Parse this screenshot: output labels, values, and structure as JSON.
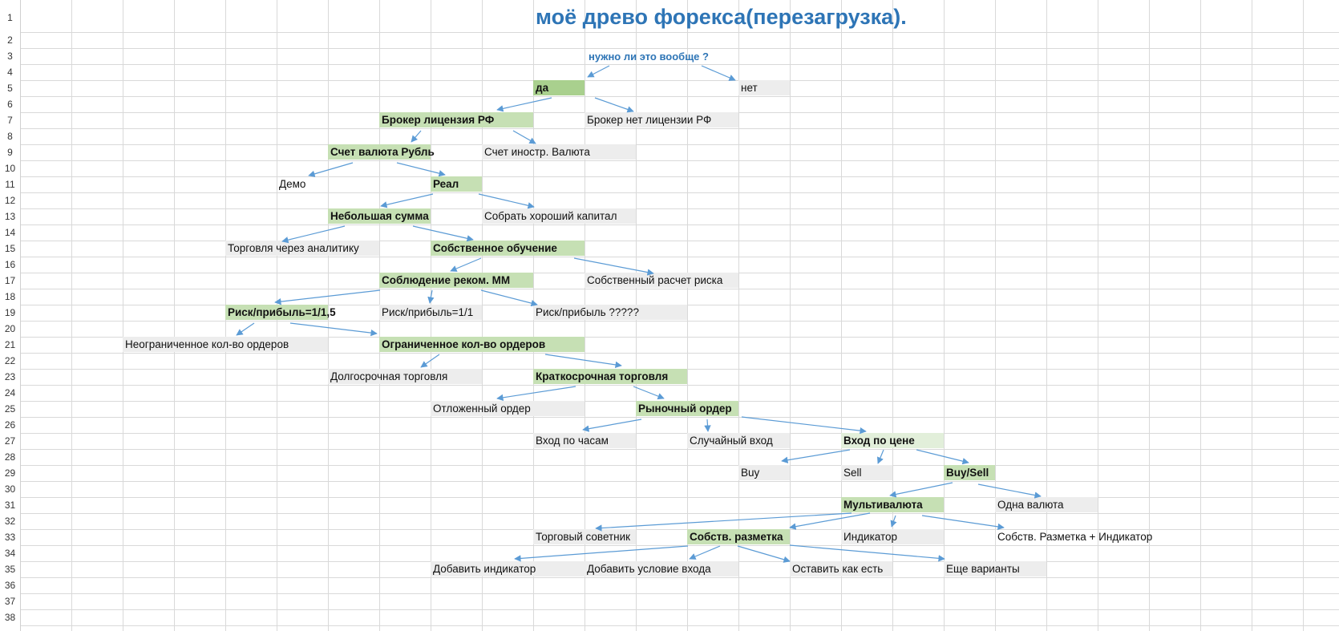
{
  "title": "моё древо форекса(перезагрузка).",
  "question": "нужно ли это вообще ?",
  "rows": [
    "1",
    "2",
    "3",
    "4",
    "5",
    "6",
    "7",
    "8",
    "9",
    "10",
    "11",
    "12",
    "13",
    "14",
    "15",
    "16",
    "17",
    "18",
    "19",
    "20",
    "21",
    "22",
    "23",
    "24",
    "25",
    "26",
    "27",
    "28",
    "29",
    "30",
    "31",
    "32",
    "33",
    "34",
    "35",
    "36",
    "37",
    "38"
  ],
  "nodes": {
    "da": "да",
    "net": "нет",
    "broker_rf": "Брокер лицензия РФ",
    "broker_no_rf": "Брокер нет лицензии РФ",
    "rub": "Счет валюта Рубль",
    "foreign": "Счет иностр. Валюта",
    "demo": "Демо",
    "real": "Реал",
    "small_sum": "Небольшая сумма",
    "capital": "Собрать хороший капитал",
    "analytics": "Торговля через аналитику",
    "self_study": "Собственное обучение",
    "mm": "Соблюдение реком. ММ",
    "own_risk": "Собственный расчет риска",
    "rr15": "Риск/прибыль=1/1,5",
    "rr11": "Риск/прибыль=1/1",
    "rrq": "Риск/прибыль ?????",
    "unlimited": "Неограниченное кол-во ордеров",
    "limited": "Ограниченное кол-во ордеров",
    "long_term": "Долгосрочная торговля",
    "short_term": "Краткосрочная торговля",
    "pending": "Отложенный ордер",
    "market": "Рыночный ордер",
    "by_hours": "Вход по часам",
    "random": "Случайный вход",
    "by_price": "Вход по цене",
    "buy": "Buy",
    "sell": "Sell",
    "buysell": "Buy/Sell",
    "multi": "Мультивалюта",
    "one_cur": "Одна валюта",
    "advisor": "Торговый советник",
    "own_markup": "Собств. разметка",
    "indicator": "Индикатор",
    "markup_ind": "Собств. Разметка + Индикатор",
    "add_ind": "Добавить индикатор",
    "add_cond": "Добавить условие входа",
    "leave": "Оставить как есть",
    "more": "Еще варианты"
  },
  "colors": {
    "title": "#2e75b6",
    "arrow": "#5b9bd5",
    "green_dark": "#a9d08e",
    "green": "#c6e0b4",
    "green_light": "#e2efda",
    "gray": "#ededed",
    "grid": "#d9d9d9"
  }
}
